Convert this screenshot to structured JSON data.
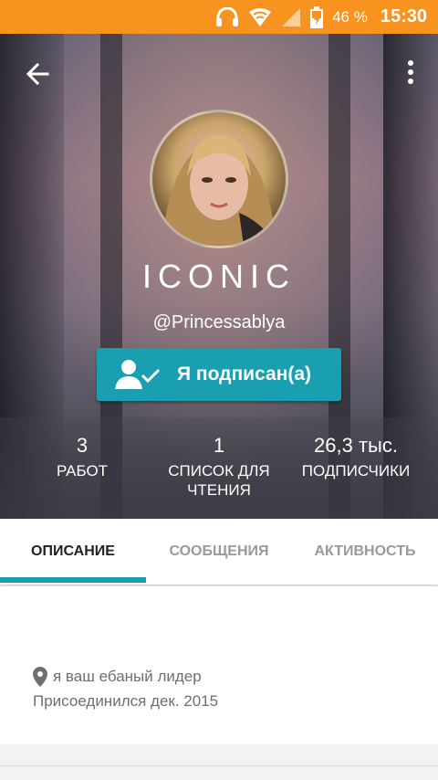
{
  "status_bar": {
    "battery_percent": "46 %",
    "time": "15:30",
    "icons": [
      "headphones-icon",
      "wifi-icon",
      "signal-icon",
      "battery-icon"
    ],
    "bg_color": "#f7931e"
  },
  "header": {
    "back_icon": "arrow-left-icon",
    "menu_icon": "more-vert-icon"
  },
  "profile": {
    "display_name": "ICONIC",
    "handle": "@Princessablya",
    "follow_button_label": "Я подписан(а)",
    "follow_icon": "person-check-icon",
    "accent_color": "#1a9fb1"
  },
  "stats": [
    {
      "value": "3",
      "label": "РАБОТ"
    },
    {
      "value": "1",
      "label_line1": "СПИСОК ДЛЯ",
      "label_line2": "ЧТЕНИЯ"
    },
    {
      "value": "26,3 тыс.",
      "label": "ПОДПИСЧИКИ"
    }
  ],
  "tabs": [
    {
      "label": "ОПИСАНИЕ",
      "active": true
    },
    {
      "label": "СООБЩЕНИЯ",
      "active": false
    },
    {
      "label": "АКТИВНОСТЬ",
      "active": false
    }
  ],
  "about": {
    "location_icon": "location-pin-icon",
    "location": "я ваш ебаный лидер",
    "joined": "Присоединился дек. 2015"
  }
}
